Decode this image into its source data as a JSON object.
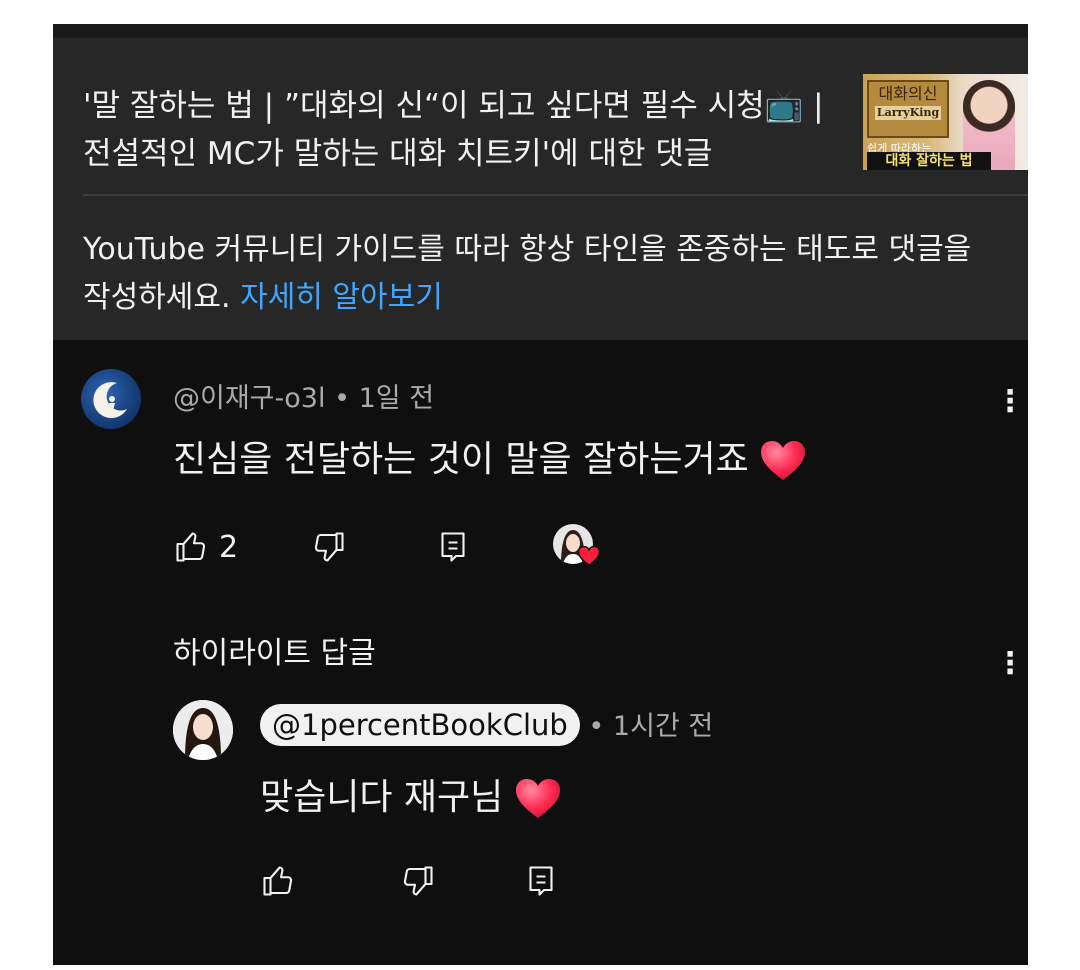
{
  "video": {
    "title": "'말 잘하는 법 | ”대화의 신“이 되고 싶다면 필수 시청📺 | 전설적인 MC가 말하는 대화 치트키'에 대한 댓글",
    "thumbnail": {
      "book_title": "대화의신",
      "book_author": "LarryKing",
      "subtitle": "쉽게 따라하는",
      "banner": "대화 잘하는 법"
    }
  },
  "guideline": {
    "text": "YouTube 커뮤니티 가이드를 따라 항상 타인을 존중하는 태도로 댓글을 작성하세요.",
    "link": "자세히 알아보기"
  },
  "comment": {
    "author": "@이재구-o3l",
    "separator": "•",
    "time": "1일 전",
    "text": "진심을 전달하는 것이 말을 잘하는거죠",
    "like_count": "2",
    "more_icon": "kebab-icon"
  },
  "highlight": {
    "label": "하이라이트 답글"
  },
  "reply": {
    "author": "@1percentBookClub",
    "separator": "•",
    "time": "1시간 전",
    "text": "맞습니다 재구님"
  },
  "icons": {
    "like": "thumbs-up-icon",
    "dislike": "thumbs-down-icon",
    "reply": "reply-icon",
    "heart": "heart-emoji-icon"
  },
  "colors": {
    "background": "#0f0f0f",
    "panel": "#272727",
    "link": "#3ea6ff",
    "text": "#f1f1f1",
    "meta": "#aaaaaa",
    "heart": "#ff2d55"
  }
}
